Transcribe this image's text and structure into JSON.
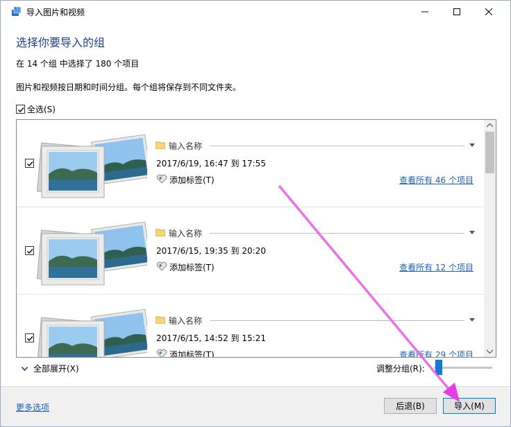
{
  "window": {
    "title": "导入图片和视频",
    "heading": "选择你要导入的组",
    "summary": "在 14 个组 中选择了 180 个项目",
    "description": "图片和视频按日期和时间分组。每个组将保存到不同文件夹。",
    "select_all_label": "全选(S)",
    "select_all_checked": true
  },
  "groups": [
    {
      "checked": true,
      "name_placeholder": "输入名称",
      "date_range": "2017/6/19, 16:47 到 17:55",
      "tag_label": "添加标签(T)",
      "view_all": "查看所有 46 个项目"
    },
    {
      "checked": true,
      "name_placeholder": "输入名称",
      "date_range": "2017/6/15, 19:35 到 20:20",
      "tag_label": "添加标签(T)",
      "view_all": "查看所有 12 个项目"
    },
    {
      "checked": true,
      "name_placeholder": "输入名称",
      "date_range": "2017/6/15, 14:52 到 15:21",
      "tag_label": "添加标签(T)",
      "view_all": "查看所有 29 个项目"
    }
  ],
  "controls": {
    "expand_all": "全部展开(X)",
    "adjust_groups": "调整分组(R):",
    "more_options": "更多选项",
    "back_button": "后退(B)",
    "import_button": "导入(M)"
  },
  "colors": {
    "accent": "#1478d4",
    "link": "#1f5fb5",
    "heading": "#1e3f8f",
    "annotation_arrow": "#e63ce6"
  }
}
